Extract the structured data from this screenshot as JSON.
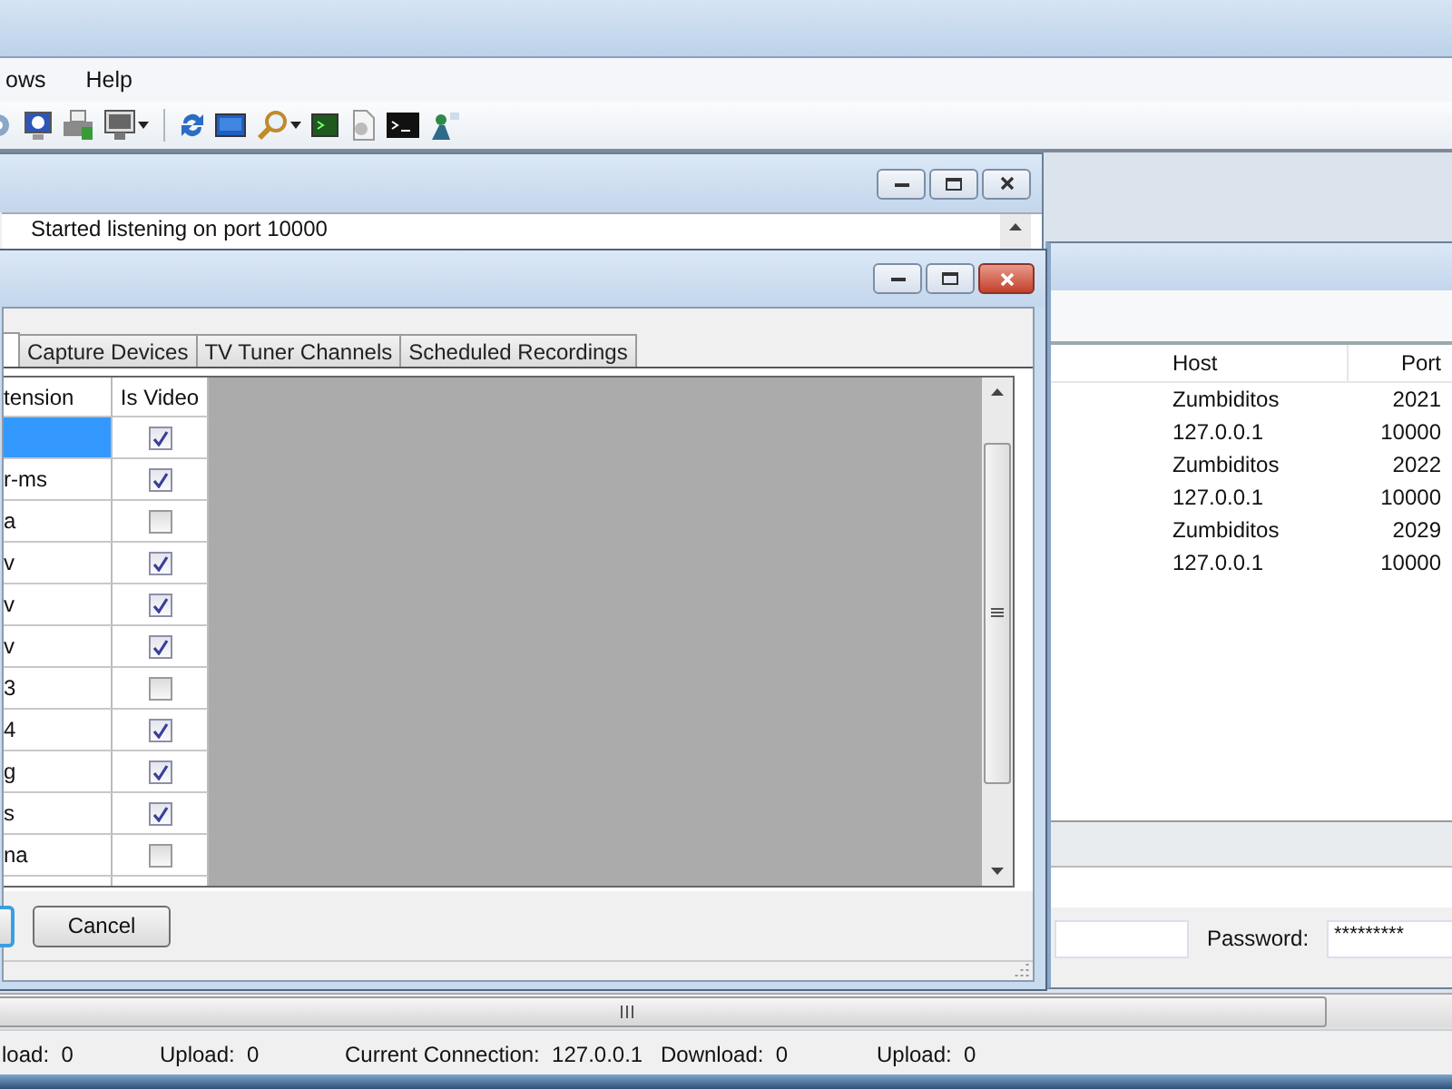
{
  "menu": [
    {
      "label": "ows"
    },
    {
      "label": "Help"
    }
  ],
  "log_window": {
    "lines": [
      "Started listening on port 10000"
    ]
  },
  "connections_window": {
    "columns": [
      "Host",
      "Port"
    ],
    "rows": [
      {
        "host": "Zumbiditos",
        "port": "2021"
      },
      {
        "host": "127.0.0.1",
        "port": "10000"
      },
      {
        "host": "Zumbiditos",
        "port": "2022"
      },
      {
        "host": "127.0.0.1",
        "port": "10000"
      },
      {
        "host": "Zumbiditos",
        "port": "2029"
      },
      {
        "host": "127.0.0.1",
        "port": "10000"
      }
    ],
    "password": {
      "label": "Password:",
      "value": "*********"
    }
  },
  "dialog": {
    "tabs": [
      {
        "selected": true
      },
      {
        "label": "Capture Devices",
        "selected": false
      },
      {
        "label": "TV Tuner Channels",
        "selected": false
      },
      {
        "label": "Scheduled Recordings",
        "selected": false
      }
    ],
    "columns": [
      "tension",
      "Is Video"
    ],
    "rows": [
      {
        "selected": true,
        "is_video": true
      },
      {
        "extension": "r-ms",
        "selected": false,
        "is_video": true
      },
      {
        "extension": "a",
        "selected": false,
        "is_video": false
      },
      {
        "extension": "v",
        "selected": false,
        "is_video": true
      },
      {
        "extension": "v",
        "selected": false,
        "is_video": true
      },
      {
        "extension": "v",
        "selected": false,
        "is_video": true
      },
      {
        "extension": "3",
        "selected": false,
        "is_video": false
      },
      {
        "extension": "4",
        "selected": false,
        "is_video": true
      },
      {
        "extension": "g",
        "selected": false,
        "is_video": true
      },
      {
        "extension": "s",
        "selected": false,
        "is_video": true
      },
      {
        "extension": "na",
        "selected": false,
        "is_video": false
      }
    ],
    "cancel_button": "Cancel"
  },
  "status_bar": [
    {
      "label": "load:",
      "value": "0"
    },
    {
      "label": "Upload:",
      "value": "0"
    },
    {
      "label": "Current Connection:",
      "value": "127.0.0.1"
    },
    {
      "label": "Download:",
      "value": "0"
    },
    {
      "label": "Upload:",
      "value": "0"
    }
  ]
}
